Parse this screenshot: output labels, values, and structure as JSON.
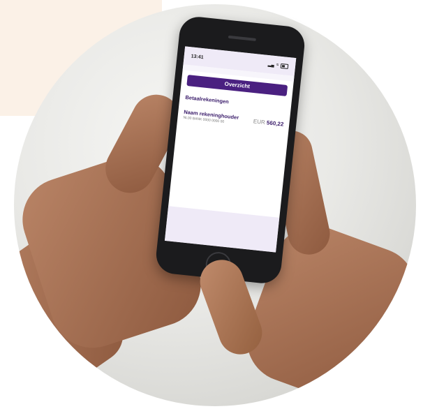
{
  "status_bar": {
    "time": "13:41",
    "icons": [
      "signal-icon",
      "wifi-icon",
      "battery-icon"
    ]
  },
  "app": {
    "overview_button": "Overzicht",
    "section_title": "Betaalrekeningen",
    "account": {
      "holder_name": "Naam rekeninghouder",
      "iban": "NL00 BANK 0000 0000 00",
      "currency": "EUR",
      "balance": "560,22"
    }
  },
  "colors": {
    "brand_purple": "#4a2080",
    "text_purple": "#3b1d6b",
    "peach_background": "#fbf1e7",
    "screen_tint": "#efeaf7"
  }
}
